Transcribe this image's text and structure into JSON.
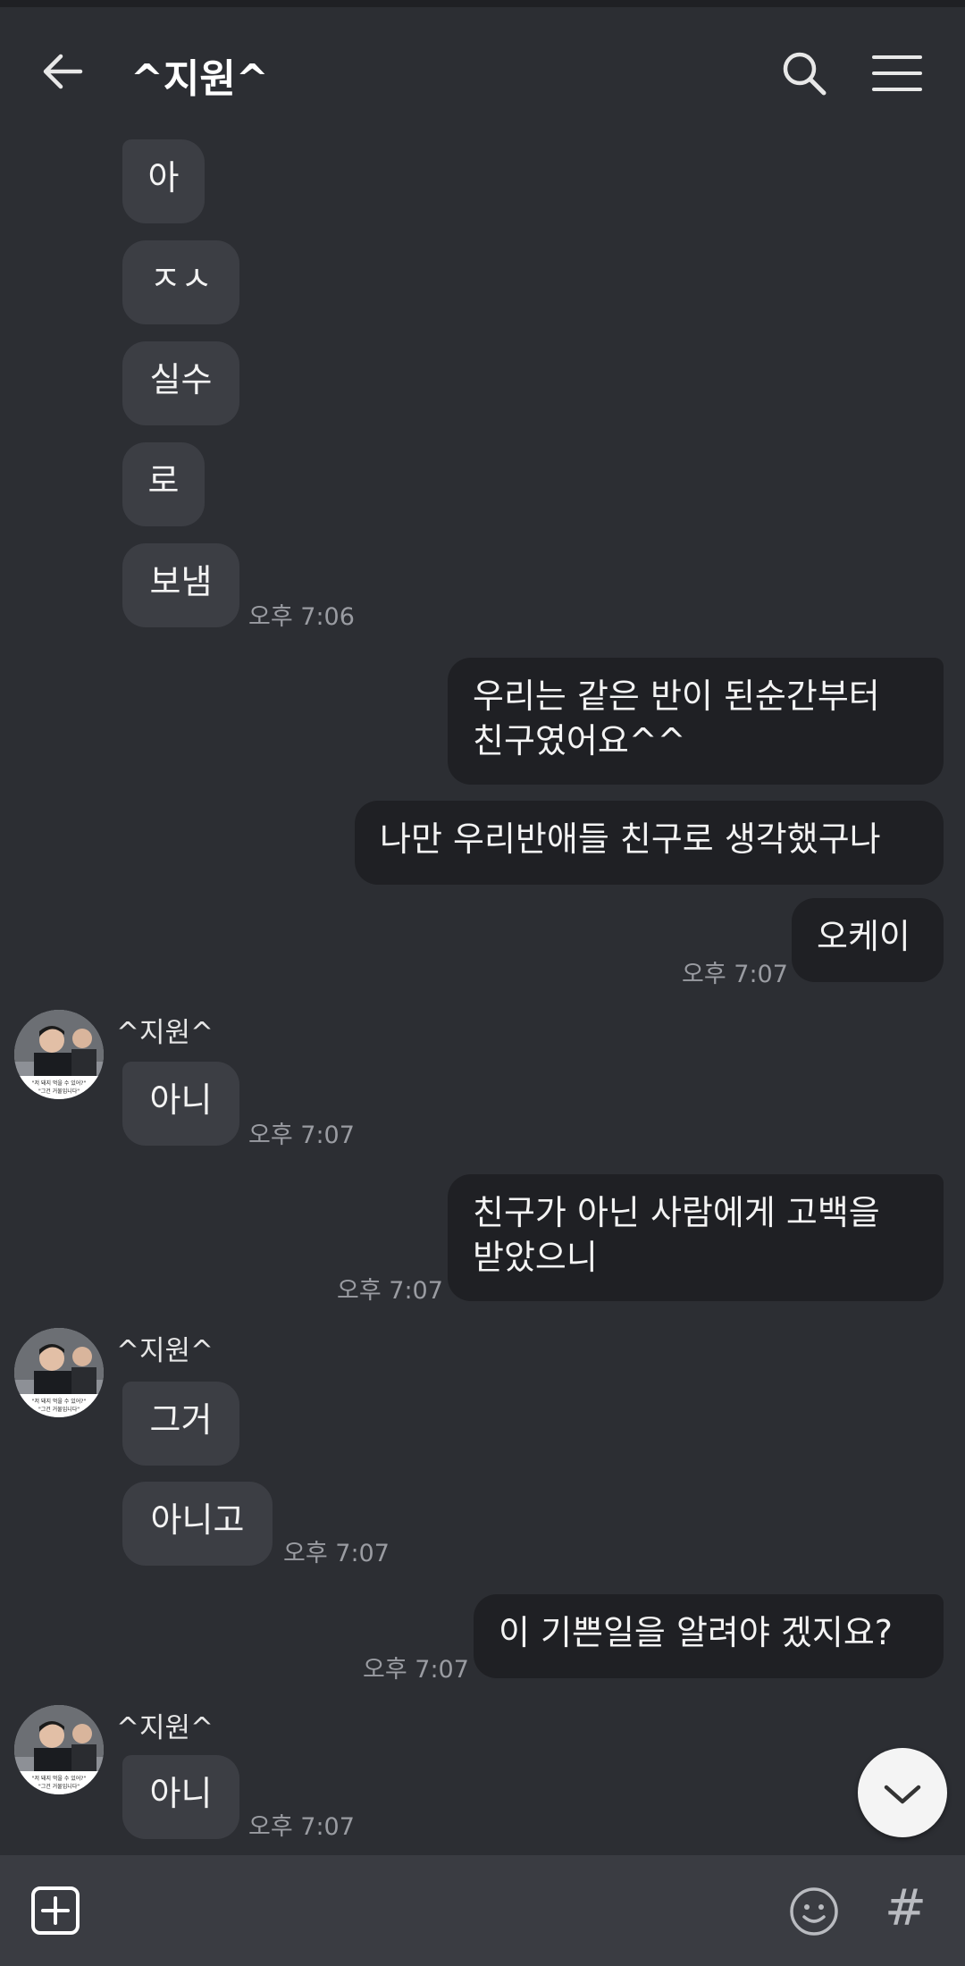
{
  "header": {
    "title": "^지원^",
    "back_icon": "arrow-left-icon",
    "search_icon": "search-icon",
    "menu_icon": "hamburger-menu-icon"
  },
  "messages": {
    "m1": "아",
    "m2": "ㅈㅅ",
    "m3": "실수",
    "m4": "로",
    "m5": "보냄",
    "t1": "오후 7:06",
    "m6_line1": "우리는 같은 반이 된순간부터",
    "m6_line2": "친구였어요^^",
    "m7": "나만 우리반애들 친구로 생각했구나",
    "m8": "오케이",
    "t2": "오후 7:07",
    "sender1": "^지원^",
    "m9": "아니",
    "t3": "오후 7:07",
    "m10_line1": "친구가 아닌 사람에게 고백을",
    "m10_line2": "받았으니",
    "t4": "오후 7:07",
    "sender2": "^지원^",
    "m11": "그거",
    "m12": "아니고",
    "t5": "오후 7:07",
    "m13": "이 기쁜일을 알려야 겠지요?",
    "t6": "오후 7:07",
    "sender3": "^지원^",
    "m14": "아니",
    "t7": "오후 7:07"
  },
  "avatar_caption": {
    "line1": "\"저 돼지 먹을 수 있어?\"",
    "line2": "\"그건 거물입니다\""
  },
  "input_bar": {
    "attach_icon": "plus-box-icon",
    "emoji_icon": "smiley-icon",
    "hashtag_icon": "hashtag-icon",
    "hashtag_glyph": "#"
  },
  "scroll_button_icon": "chevron-down-icon",
  "colors": {
    "background": "#2c2e33",
    "incoming_bubble": "#3c3e44",
    "outgoing_bubble": "#1f2024",
    "timestamp": "#9a9ca2"
  }
}
